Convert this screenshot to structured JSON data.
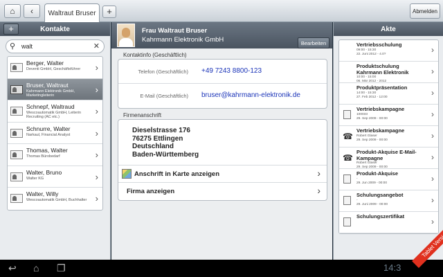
{
  "topbar": {
    "home_icon": "home-icon",
    "back_icon": "back-arrow-icon",
    "tab_label": "Waltraut Bruser",
    "add_tab": "+",
    "logout_label": "Abmelden"
  },
  "contacts": {
    "header": "Kontakte",
    "add_label": "+",
    "search_value": "walt",
    "items": [
      {
        "name": "Berger, Walter",
        "sub": "Deventi GmbH, Geschäftsführer",
        "selected": false
      },
      {
        "name": "Bruser, Waltraut",
        "sub": "Kahrmann Elektronik GmbH, Marketingleiterin",
        "selected": true
      },
      {
        "name": "Schnepf, Waltraud",
        "sub": "Wescoautomatik GmbH, Leiterin Recruiting (AC etc.)",
        "selected": false
      },
      {
        "name": "Schnurre, Walter",
        "sub": "Narkaul, Financial Analyst",
        "selected": false
      },
      {
        "name": "Thomas, Walter",
        "sub": "Thomas Bürobedarf",
        "selected": false
      },
      {
        "name": "Walter, Bruno",
        "sub": "Walter KG",
        "selected": false
      },
      {
        "name": "Walter, Willy",
        "sub": "Wescoautomatik GmbH, Buchhalter",
        "selected": false
      }
    ]
  },
  "detail": {
    "name": "Frau Waltraut Bruser",
    "company": "Kahrmann Elektronik GmbH",
    "edit_label": "Bearbeiten",
    "kontakt_title": "Kontaktinfo (Geschäftlich)",
    "phone_label": "Telefon (Geschäftlich)",
    "phone_value": "+49 7243 8800-123",
    "email_label": "E-Mail (Geschäftlich)",
    "email_value": "bruser@kahrmann-elektronik.de",
    "address_title": "Firmenanschrift",
    "address_lines": [
      "Dieselstrasse 176",
      "76275 Ettlingen",
      "Deutschland",
      "Baden-Württemberg"
    ],
    "map_label": "Anschrift in Karte anzeigen",
    "company_label": "Firma anzeigen"
  },
  "akte": {
    "header": "Akte",
    "items": [
      {
        "icon": "clock",
        "title": "Vertriebsschulung",
        "meta": [
          "09:00 - 15:30",
          "22. Juni 2012 - 4.0?"
        ]
      },
      {
        "icon": "clock",
        "title": "Produktschulung Kahrmann Elektronik",
        "meta": [
          "10:00 - 15:00",
          "06. Mär 2012 - 2012"
        ]
      },
      {
        "icon": "clock",
        "title": "Produktpräsentation",
        "meta": [
          "14:00 - 15:30",
          "27. Feb 2012 - 12:00"
        ]
      },
      {
        "icon": "doc",
        "title": "Vertriebskampagne",
        "meta": [
          "100033",
          "29. Sep 2009 - 00:00"
        ]
      },
      {
        "icon": "phone",
        "title": "Vertriebskampagne",
        "meta": [
          "Robert Glaser",
          "29. Sep 2009 - 00:00"
        ]
      },
      {
        "icon": "phone",
        "title": "Produkt-Akquise E-Mail-Kampagne",
        "meta": [
          "Robert Glaser",
          "29. Sep 2009 - 00:00"
        ]
      },
      {
        "icon": "doc",
        "title": "Produkt-Akquise",
        "meta": [
          "-",
          "29. Jun 2009 - 00:00"
        ]
      },
      {
        "icon": "doc",
        "title": "Schulungsangebot",
        "meta": [
          "-",
          "29. Juni 2009 - 00:00"
        ]
      },
      {
        "icon": "doc",
        "title": "Schulungszertifikat",
        "meta": []
      }
    ]
  },
  "system": {
    "time": "14:3",
    "banner": "Tablet Version"
  }
}
